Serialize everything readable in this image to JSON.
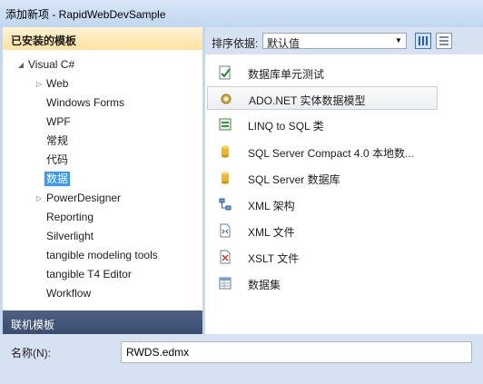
{
  "window": {
    "title": "添加新项 - RapidWebDevSample"
  },
  "left_panel": {
    "header": "已安装的模板",
    "tree": [
      {
        "label": "Visual C#",
        "expander": "◢"
      },
      {
        "label": "Web",
        "expander": "▷"
      },
      {
        "label": "Windows Forms"
      },
      {
        "label": "WPF"
      },
      {
        "label": "常规"
      },
      {
        "label": "代码"
      },
      {
        "label": "数据",
        "selected": true
      },
      {
        "label": "PowerDesigner",
        "expander": "▷"
      },
      {
        "label": "Reporting"
      },
      {
        "label": "Silverlight"
      },
      {
        "label": "tangible modeling tools"
      },
      {
        "label": "tangible T4 Editor"
      },
      {
        "label": "Workflow"
      }
    ],
    "online_templates": "联机模板"
  },
  "sort_bar": {
    "label": "排序依据:",
    "selected": "默认值"
  },
  "templates": [
    {
      "label": "数据库单元测试",
      "icon": "unit-test-icon"
    },
    {
      "label": "ADO.NET 实体数据模型",
      "icon": "entity-model-icon",
      "selected": true
    },
    {
      "label": "LINQ to SQL 类",
      "icon": "linq-icon"
    },
    {
      "label": "SQL Server Compact 4.0 本地数...",
      "icon": "database-icon"
    },
    {
      "label": "SQL Server 数据库",
      "icon": "database-icon"
    },
    {
      "label": "XML 架构",
      "icon": "xml-schema-icon"
    },
    {
      "label": "XML 文件",
      "icon": "xml-file-icon"
    },
    {
      "label": "XSLT 文件",
      "icon": "xslt-file-icon"
    },
    {
      "label": "数据集",
      "icon": "dataset-icon"
    }
  ],
  "bottom": {
    "name_label": "名称(N):",
    "name_value": "RWDS.edmx"
  },
  "colors": {
    "selection": "#3399ff",
    "header_gold": "#ffe29f",
    "online_bar": "#3a4d70"
  }
}
